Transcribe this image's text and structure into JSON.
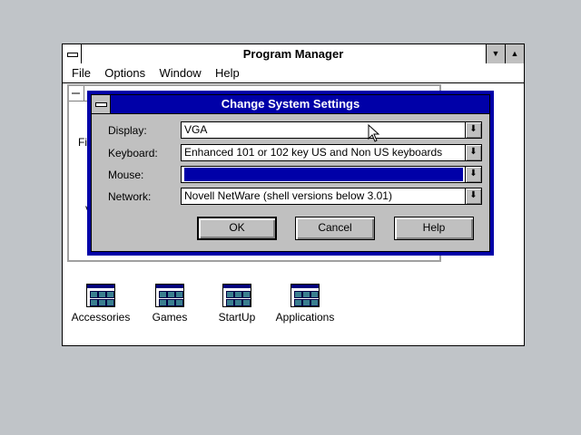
{
  "program_manager": {
    "title": "Program Manager",
    "menu": [
      "File",
      "Options",
      "Window",
      "Help"
    ],
    "group_window_fragments": [
      "Fil",
      "V"
    ]
  },
  "group_icons": [
    "Accessories",
    "Games",
    "StartUp",
    "Applications"
  ],
  "dialog": {
    "title": "Change System Settings",
    "fields": [
      {
        "label": "Display:",
        "value": "VGA"
      },
      {
        "label": "Keyboard:",
        "value": "Enhanced 101 or 102 key US and Non US keyboards"
      },
      {
        "label": "Mouse:",
        "value": ""
      },
      {
        "label": "Network:",
        "value": "Novell NetWare (shell versions below 3.01)"
      }
    ],
    "buttons": {
      "ok": "OK",
      "cancel": "Cancel",
      "help": "Help"
    }
  },
  "icons": {
    "dropdown": "down-arrow-icon",
    "system_menu": "system-menu-icon",
    "minimize": "minimize-icon",
    "maximize": "maximize-icon"
  },
  "colors": {
    "desktop": "#c0c4c8",
    "title_active": "#0000a8",
    "selection": "#0000a8"
  }
}
